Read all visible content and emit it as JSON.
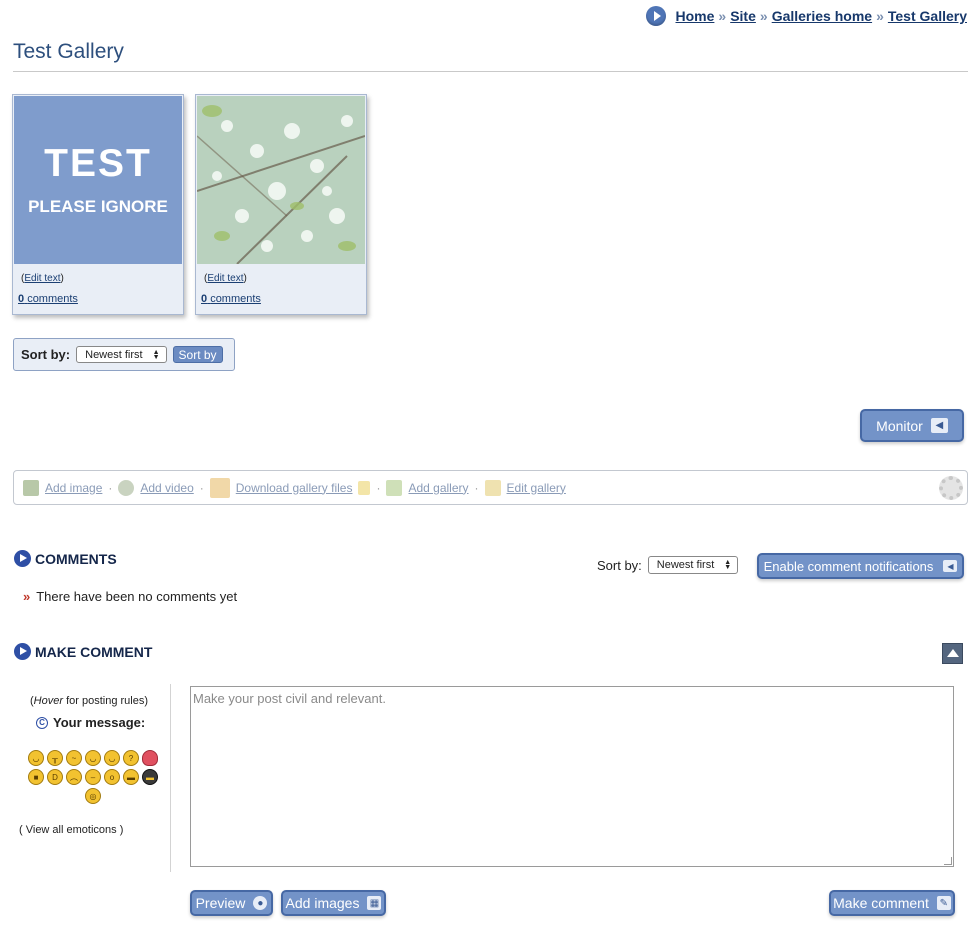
{
  "breadcrumb": {
    "items": [
      "Home",
      "Site",
      "Galleries home",
      "Test Gallery"
    ],
    "separator": "»"
  },
  "page_title": "Test Gallery",
  "gallery": {
    "cards": [
      {
        "thumb_title": "TEST",
        "thumb_subtitle": "PLEASE IGNORE",
        "edit_label": "Edit text",
        "comment_count": "0",
        "comments_label": "comments"
      },
      {
        "thumb_title": "",
        "thumb_subtitle": "",
        "edit_label": "Edit text",
        "comment_count": "0",
        "comments_label": "comments"
      }
    ]
  },
  "sort": {
    "label": "Sort by:",
    "selected": "Newest first",
    "button": "Sort by"
  },
  "monitor_button": "Monitor",
  "actions": {
    "add_image": "Add image",
    "add_video": "Add video",
    "download": "Download gallery files",
    "add_gallery": "Add gallery",
    "edit_gallery": "Edit gallery"
  },
  "comments": {
    "heading": "COMMENTS",
    "sort_label": "Sort by:",
    "sort_selected": "Newest first",
    "notify_button": "Enable comment notifications",
    "empty_text": "There have been no comments yet"
  },
  "make_comment": {
    "heading": "MAKE COMMENT",
    "hover_word": "Hover",
    "hover_rest": "for posting rules",
    "your_message": "Your message:",
    "view_emoticons": "View all emoticons",
    "placeholder": "Make your post civil and relevant.",
    "preview_button": "Preview",
    "add_images_button": "Add images",
    "submit_button": "Make comment"
  },
  "colors": {
    "accent": "#7393c8",
    "link": "#1b3f73",
    "card_bg": "#e9eef6"
  }
}
